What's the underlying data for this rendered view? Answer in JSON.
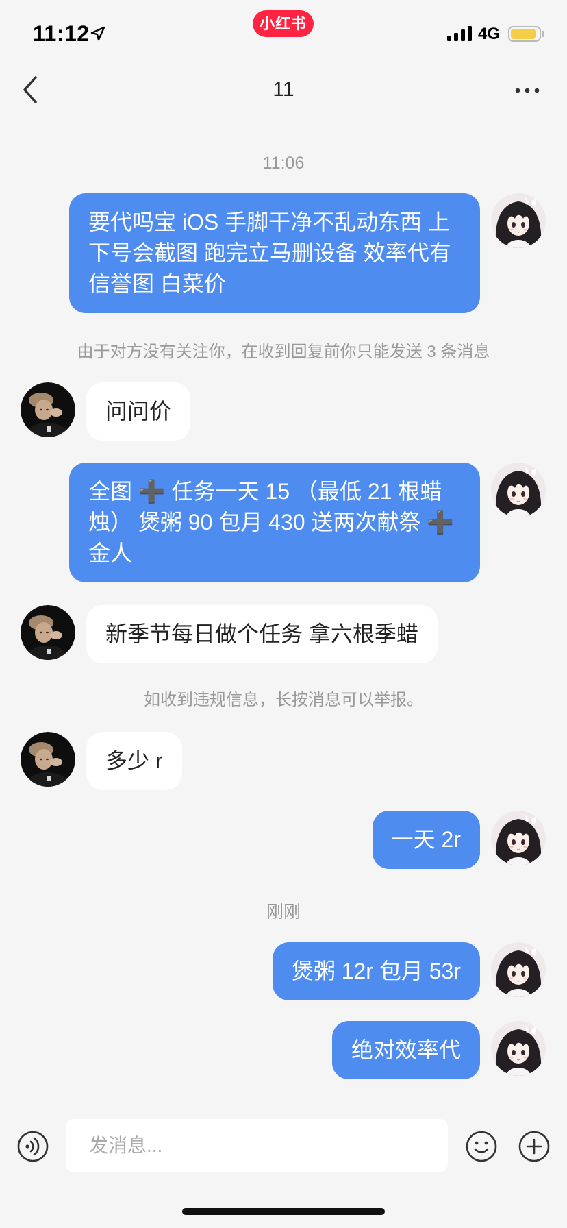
{
  "status_bar": {
    "time": "11:12",
    "app_badge": "小红书",
    "network": "4G",
    "battery_level": 0.9,
    "signal_bars": 4
  },
  "nav": {
    "title": "11"
  },
  "chat": {
    "timestamps": [
      "11:06",
      "刚刚"
    ],
    "notices": [
      "由于对方没有关注你，在收到回复前你只能发送 3 条消息",
      "如收到违规信息，长按消息可以举报。"
    ],
    "messages": [
      "要代吗宝 iOS 手脚干净不乱动东西 上下号会截图 跑完立马删设备 效率代有信誉图 白菜价",
      "问问价",
      "全图 ➕ 任务一天 15 （最低 21 根蜡烛） 煲粥 90 包月 430 送两次献祭 ➕ 金人",
      "新季节每日做个任务 拿六根季蜡",
      "多少 r",
      "一天 2r",
      "煲粥 12r 包月 53r",
      "绝对效率代"
    ]
  },
  "composer": {
    "placeholder": "发消息..."
  },
  "icons": {
    "location": "location-arrow-icon",
    "back": "chevron-left-icon",
    "more": "more-dots-icon",
    "voice": "voice-icon",
    "emoji": "emoji-icon",
    "add": "plus-circle-icon"
  },
  "colors": {
    "background": "#f5f5f5",
    "bubble_sent": "#4e8cf0",
    "bubble_received": "#ffffff",
    "badge": "#ff2442",
    "battery": "#f5cd47",
    "meta_text": "#999999"
  }
}
